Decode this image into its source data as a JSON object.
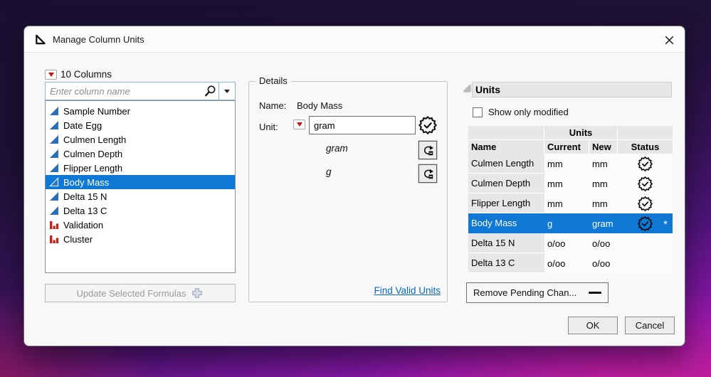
{
  "window": {
    "title": "Manage Column Units"
  },
  "columns_panel": {
    "header": "10 Columns",
    "search_placeholder": "Enter column name",
    "items": [
      {
        "label": "Sample Number",
        "type": "continuous",
        "selected": false
      },
      {
        "label": "Date Egg",
        "type": "continuous",
        "selected": false
      },
      {
        "label": "Culmen Length",
        "type": "continuous",
        "selected": false
      },
      {
        "label": "Culmen Depth",
        "type": "continuous",
        "selected": false
      },
      {
        "label": "Flipper Length",
        "type": "continuous",
        "selected": false
      },
      {
        "label": "Body Mass",
        "type": "continuous",
        "selected": true
      },
      {
        "label": "Delta 15 N",
        "type": "continuous",
        "selected": false
      },
      {
        "label": "Delta 13 C",
        "type": "continuous",
        "selected": false
      },
      {
        "label": "Validation",
        "type": "nominal",
        "selected": false
      },
      {
        "label": "Cluster",
        "type": "nominal",
        "selected": false
      }
    ],
    "update_button": "Update Selected Formulas"
  },
  "details": {
    "legend": "Details",
    "name_label": "Name:",
    "name_value": "Body Mass",
    "unit_label": "Unit:",
    "unit_value": "gram",
    "suggestions": [
      "gram",
      "g"
    ],
    "link": "Find Valid Units"
  },
  "units_panel": {
    "header": "Units",
    "checkbox_label": "Show only modified",
    "checkbox_checked": false,
    "table": {
      "group_header": "Units",
      "headers": {
        "name": "Name",
        "current": "Current",
        "new": "New",
        "status": "Status"
      },
      "rows": [
        {
          "name": "Culmen Length",
          "current": "mm",
          "new": "mm",
          "status_icon": "badge-check",
          "selected": false,
          "marker": ""
        },
        {
          "name": "Culmen Depth",
          "current": "mm",
          "new": "mm",
          "status_icon": "badge-check",
          "selected": false,
          "marker": ""
        },
        {
          "name": "Flipper Length",
          "current": "mm",
          "new": "mm",
          "status_icon": "badge-check",
          "selected": false,
          "marker": ""
        },
        {
          "name": "Body Mass",
          "current": "g",
          "new": "gram",
          "status_icon": "badge-check",
          "selected": true,
          "marker": "*"
        },
        {
          "name": "Delta 15 N",
          "current": "o/oo",
          "new": "o/oo",
          "status_icon": "",
          "selected": false,
          "marker": ""
        },
        {
          "name": "Delta 13 C",
          "current": "o/oo",
          "new": "o/oo",
          "status_icon": "",
          "selected": false,
          "marker": ""
        }
      ]
    },
    "remove_button": "Remove Pending Chan..."
  },
  "footer": {
    "ok": "OK",
    "cancel": "Cancel"
  },
  "colors": {
    "selection": "#0f77d4",
    "link": "#0a67c2",
    "continuous_icon": "#2b6fb5",
    "nominal_icon": "#bf271d"
  }
}
